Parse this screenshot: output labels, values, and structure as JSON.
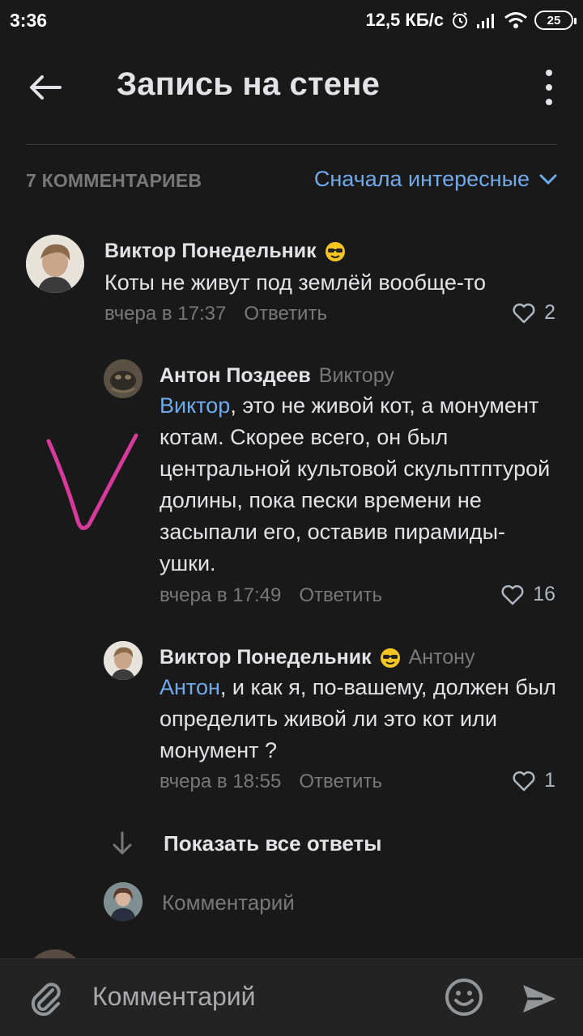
{
  "status_bar": {
    "time": "3:36",
    "network_speed": "12,5 КБ/с",
    "battery": "25",
    "icons": [
      "alarm-icon",
      "signal-icon",
      "wifi-icon",
      "battery-icon"
    ]
  },
  "header": {
    "title": "Запись на стене",
    "back_icon": "arrow-left-icon",
    "more_icon": "more-vertical-icon"
  },
  "comments_header": {
    "count_label": "7 КОММЕНТАРИЕВ",
    "sort_label": "Сначала интересные"
  },
  "comments": [
    {
      "author": "Виктор Понедельник",
      "reply_to": "",
      "mention": "",
      "text": "Коты не живут под землёй вообще-то",
      "time": "вчера в 17:37",
      "reply_label": "Ответить",
      "likes": "2"
    },
    {
      "author": "Антон Поздеев",
      "reply_to": "Виктору",
      "mention": "Виктор",
      "text": ", это не живой кот, а монумент котам. Скорее всего, он был центральной культовой скульптптурой долины, пока пески времени не засыпали его, оставив пирамиды-ушки.",
      "time": "вчера в 17:49",
      "reply_label": "Ответить",
      "likes": "16"
    },
    {
      "author": "Виктор Понедельник",
      "reply_to": "Антону",
      "mention": "Антон",
      "text": ", и как я, по-вашему, должен был определить живой ли это кот или монумент ?",
      "time": "вчера в 18:55",
      "reply_label": "Ответить",
      "likes": "1"
    }
  ],
  "show_all_replies": "Показать все ответы",
  "reply_placeholder": "Комментарий",
  "composer": {
    "placeholder": "Комментарий"
  },
  "colors": {
    "background": "#19191a",
    "accent": "#71aaeb",
    "secondary_text": "#76787a",
    "annotation_stroke": "#d63a9b"
  }
}
